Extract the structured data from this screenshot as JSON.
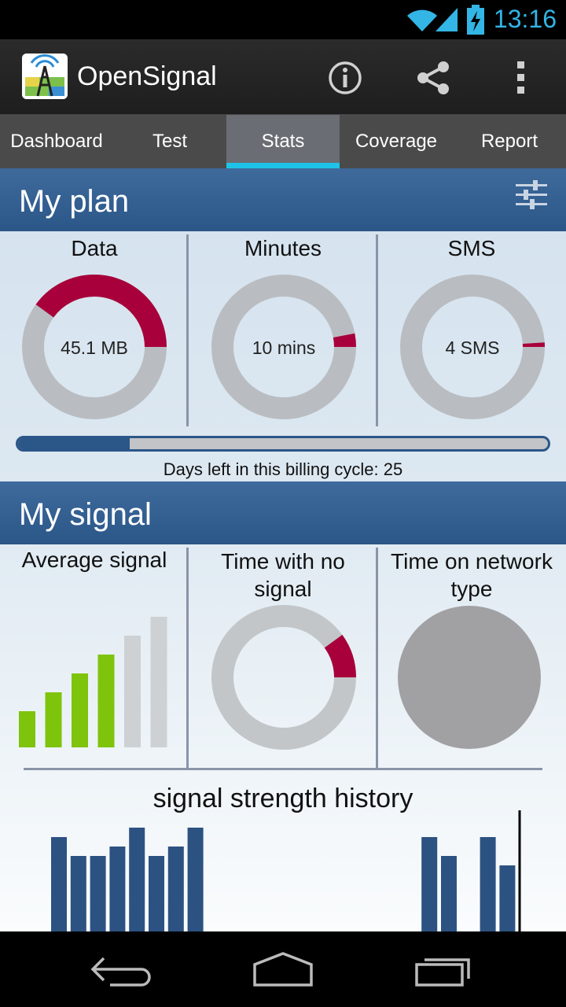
{
  "status_bar": {
    "time": "13:16"
  },
  "app": {
    "title": "OpenSignal"
  },
  "tabs": [
    {
      "label": "Dashboard",
      "active": false
    },
    {
      "label": "Test",
      "active": false
    },
    {
      "label": "Stats",
      "active": true
    },
    {
      "label": "Coverage",
      "active": false
    },
    {
      "label": "Report",
      "active": false
    }
  ],
  "my_plan": {
    "title": "My plan",
    "data": {
      "title": "Data",
      "value": "45.1 MB",
      "used_fraction": 0.4
    },
    "minutes": {
      "title": "Minutes",
      "value": "10 mins",
      "used_fraction": 0.03
    },
    "sms": {
      "title": "SMS",
      "value": "4 SMS",
      "used_fraction": 0.01
    },
    "billing": {
      "text": "Days left in this billing cycle: 25",
      "elapsed_fraction": 0.21
    }
  },
  "my_signal": {
    "title": "My signal",
    "average_signal": {
      "title": "Average signal",
      "bars_filled": 4,
      "bars_total": 6
    },
    "time_no_signal": {
      "title": "Time with no signal",
      "fraction": 0.1
    },
    "time_network_type": {
      "title": "Time on network type"
    },
    "history": {
      "title": "signal strength history",
      "bars": [
        5,
        4,
        4,
        4.5,
        5.5,
        4,
        4.5,
        5.5,
        0,
        0,
        0,
        0,
        0,
        0,
        0,
        0,
        0,
        0,
        0,
        5,
        4,
        0,
        5,
        3.5
      ]
    }
  },
  "colors": {
    "accent": "#1ec3e8",
    "header_blue": "#2b5688",
    "used_red": "#a8003a",
    "track_gray": "#b9bdc1",
    "signal_green": "#7ec40d",
    "signal_empty": "#cdd1d4",
    "network_gray": "#a1a1a4",
    "history_bar": "#2c5282"
  }
}
